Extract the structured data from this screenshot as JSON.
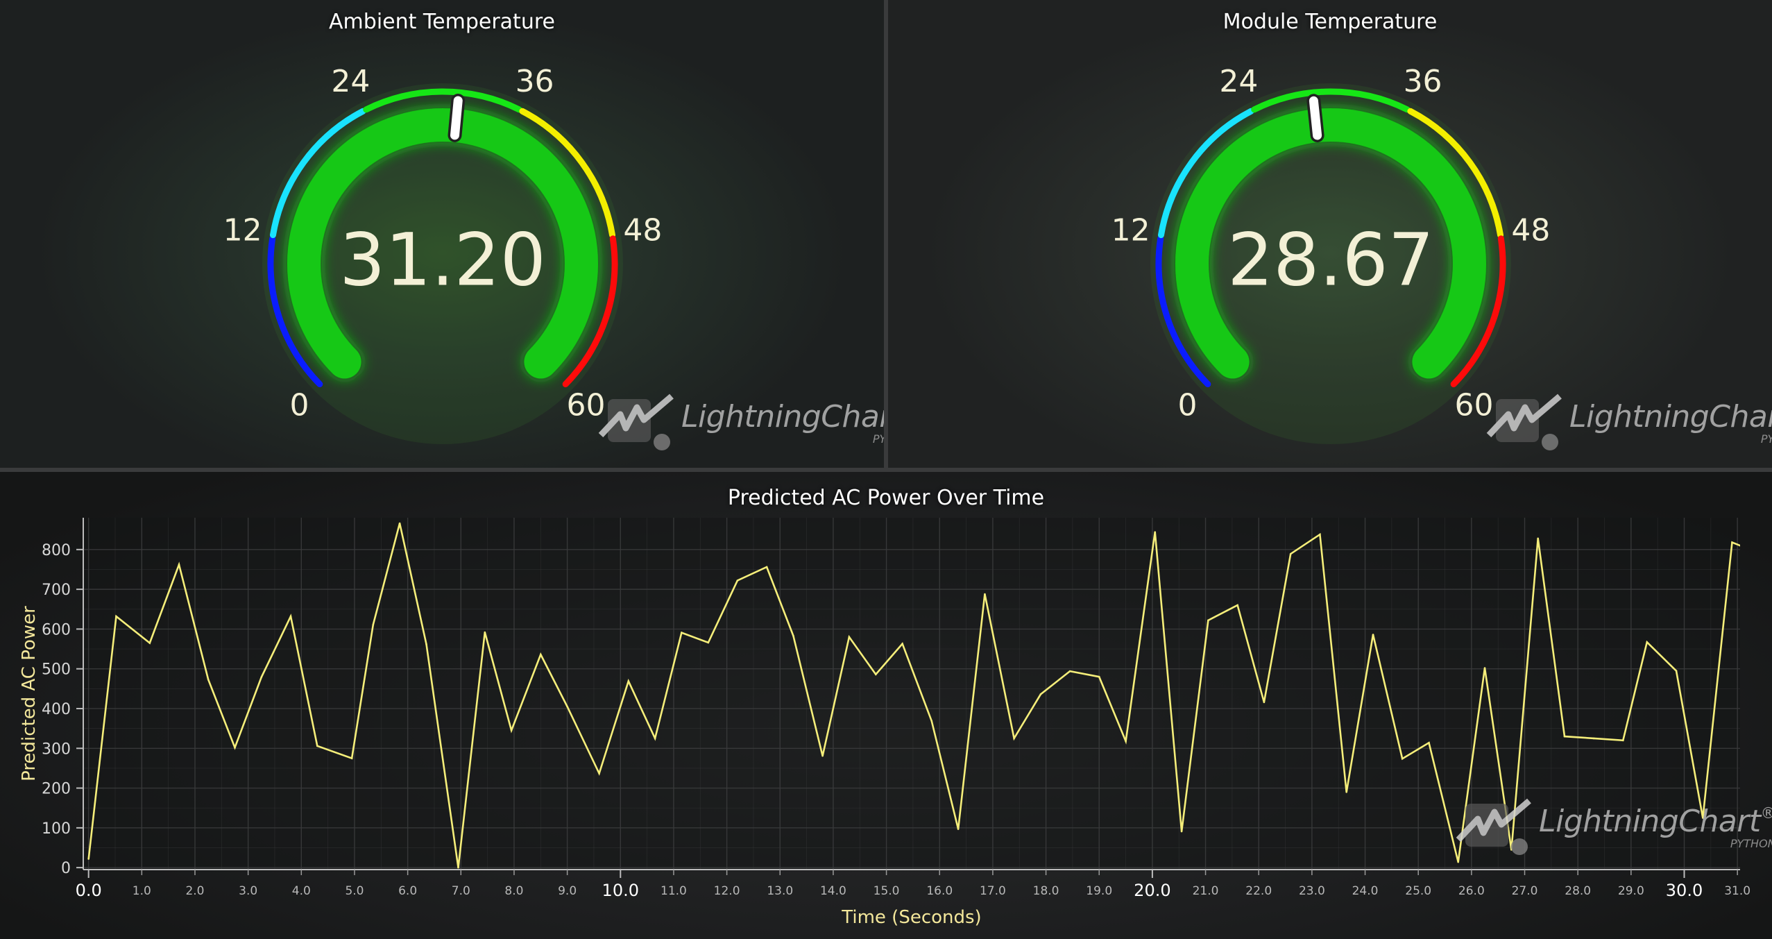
{
  "gauges": [
    {
      "title": "Ambient Temperature",
      "value_text": "31.20",
      "value": 31.2,
      "min": 0,
      "max": 60,
      "ticks": [
        "0",
        "12",
        "24",
        "36",
        "48",
        "60"
      ]
    },
    {
      "title": "Module Temperature",
      "value_text": "28.67",
      "value": 28.67,
      "min": 0,
      "max": 60,
      "ticks": [
        "0",
        "12",
        "24",
        "36",
        "48",
        "60"
      ]
    }
  ],
  "gauge_ranges": [
    {
      "from": 0,
      "to": 12,
      "color": "#0a1cff"
    },
    {
      "from": 12,
      "to": 24,
      "color": "#19e3ff"
    },
    {
      "from": 24,
      "to": 36,
      "color": "#16e616"
    },
    {
      "from": 36,
      "to": 48,
      "color": "#f5ef00"
    },
    {
      "from": 48,
      "to": 60,
      "color": "#ff0a0a"
    }
  ],
  "colors": {
    "gauge_fill": "#12c812",
    "gauge_track": "#262a26",
    "needle": "#ffffff",
    "line": "#f5ee7a",
    "grid": "#3a3b3c"
  },
  "brand": {
    "name": "LightningChart",
    "registered": "®",
    "sub": "PYTHON",
    "icon": "lightningchart-logo-icon"
  },
  "chart_data": {
    "type": "line",
    "title": "Predicted AC Power Over Time",
    "xlabel": "Time (Seconds)",
    "ylabel": "Predicted AC Power",
    "xlim": [
      -0.1,
      31.05
    ],
    "ylim": [
      -5,
      880
    ],
    "grid": true,
    "x_ticks_major": [
      "0.0",
      "10.0",
      "20.0",
      "30.0"
    ],
    "x_ticks_minor": [
      "1.0",
      "2.0",
      "3.0",
      "4.0",
      "5.0",
      "6.0",
      "7.0",
      "8.0",
      "9.0",
      "11.0",
      "12.0",
      "13.0",
      "14.0",
      "15.0",
      "16.0",
      "17.0",
      "18.0",
      "19.0",
      "21.0",
      "22.0",
      "23.0",
      "24.0",
      "25.0",
      "26.0",
      "27.0",
      "28.0",
      "29.0",
      "31.0"
    ],
    "y_ticks": [
      "0",
      "100",
      "200",
      "300",
      "400",
      "500",
      "600",
      "700",
      "800"
    ],
    "series": [
      {
        "x": [
          0.0,
          0.52,
          1.15,
          1.7,
          2.25,
          2.75,
          3.25,
          3.8,
          4.3,
          4.95,
          5.35,
          5.85,
          6.35,
          6.95,
          7.45,
          7.95,
          8.5,
          9.0,
          9.6,
          10.15,
          10.65,
          11.15,
          11.65,
          12.2,
          12.75,
          13.25,
          13.8,
          14.3,
          14.8,
          15.3,
          15.85,
          16.35,
          16.85,
          17.4,
          17.9,
          18.45,
          19.0,
          19.5,
          20.05,
          20.55,
          21.05,
          21.6,
          22.1,
          22.6,
          23.15,
          23.65,
          24.15,
          24.7,
          25.2,
          25.75,
          26.25,
          26.75,
          27.25,
          27.75,
          28.3,
          28.85,
          29.3,
          29.85,
          30.35,
          30.9,
          31.05
        ],
        "y": [
          22,
          632,
          565,
          762,
          473,
          302,
          479,
          632,
          306,
          275,
          611,
          866,
          562,
          0,
          592,
          345,
          536,
          405,
          237,
          469,
          325,
          591,
          566,
          722,
          756,
          583,
          281,
          580,
          486,
          563,
          369,
          97,
          688,
          325,
          436,
          494,
          480,
          318,
          844,
          91,
          622,
          660,
          416,
          789,
          838,
          190,
          586,
          274,
          314,
          14,
          502,
          45,
          828,
          330,
          325,
          320,
          567,
          495,
          125,
          818,
          810
        ]
      }
    ]
  }
}
